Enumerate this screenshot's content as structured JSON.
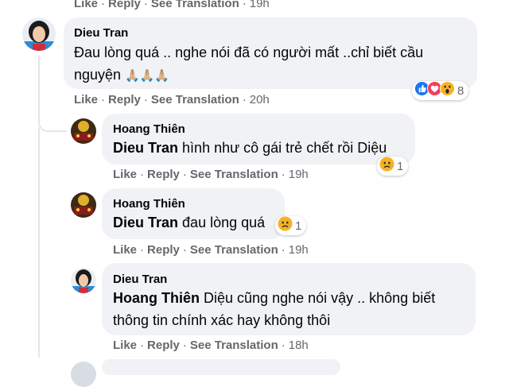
{
  "actions": {
    "like": "Like",
    "reply": "Reply",
    "see_translation": "See Translation",
    "separator": "·"
  },
  "top_partial": {
    "time": "19h"
  },
  "comments": [
    {
      "author": "Dieu Tran",
      "text_line1": "Đau lòng quá .. nghe nói đã có người mất ..chỉ biết cầu",
      "text_line2": "nguyện",
      "emoji": "🙏🏼🙏🏼🙏🏼",
      "time": "20h",
      "reactions": {
        "icons": [
          "like-icon",
          "love-icon",
          "wow-icon"
        ],
        "count": "8"
      }
    },
    {
      "author": "Hoang Thiên",
      "mention": "Dieu Tran",
      "text": "hình như cô gái trẻ chết rồi Diệu",
      "time": "19h",
      "reactions": {
        "icons": [
          "sad-icon"
        ],
        "count": "1"
      }
    },
    {
      "author": "Hoang Thiên",
      "mention": "Dieu Tran",
      "text": "đau lòng quá",
      "time": "19h",
      "reactions": {
        "icons": [
          "sad-icon"
        ],
        "count": "1"
      }
    },
    {
      "author": "Dieu Tran",
      "mention": "Hoang Thiên",
      "text_line1": "Diệu cũng nghe nói vậy .. không biết",
      "text_line2": "thông tin chính xác hay không thôi",
      "time": "18h"
    }
  ],
  "colors": {
    "bubble": "#f0f2f5",
    "meta_text": "#65676b",
    "like_blue": "#1877f2",
    "love_red": "#f33e58",
    "reaction_yellow": "#f7b125"
  }
}
